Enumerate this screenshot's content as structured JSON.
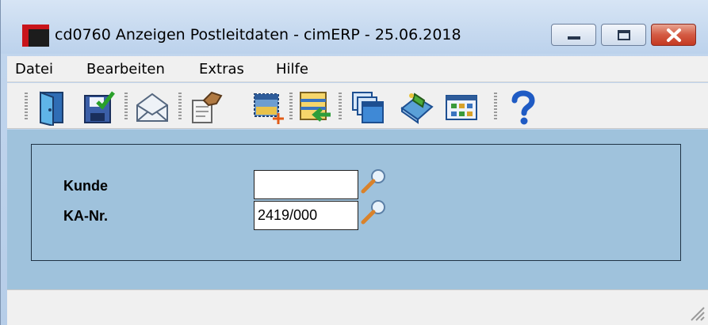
{
  "window": {
    "title": "cd0760 Anzeigen Postleitdaten - cimERP - 25.06.2018"
  },
  "menu": [
    "Datei",
    "Bearbeiten",
    "Extras",
    "Hilfe"
  ],
  "toolbar": {
    "icons": [
      "exit-door-icon",
      "save-icon",
      "mail-icon",
      "edit-hand-icon",
      "new-record-icon",
      "import-list-icon",
      "windows-icon",
      "bookmark-icon",
      "grid-view-icon",
      "help-icon"
    ]
  },
  "form": {
    "kunde_label": "Kunde",
    "kunde_value": "",
    "ka_label": "KA-Nr.",
    "ka_value": "2419/000"
  },
  "colors": {
    "content_background": "#9fc2dc",
    "title_bar": "#c6d9ef",
    "close_button": "#d45a43"
  }
}
